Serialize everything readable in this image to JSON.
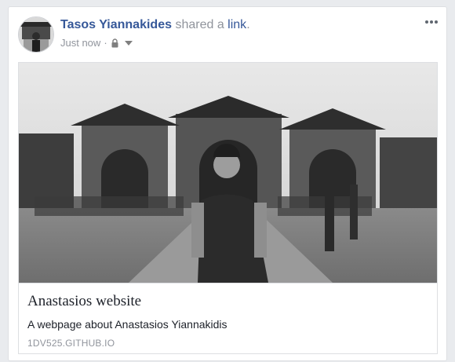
{
  "post": {
    "author": "Tasos Yiannakides",
    "action_text": "shared a",
    "link_word": "link",
    "period": ".",
    "timestamp": "Just now",
    "separator": "·",
    "privacy_icon": "lock-icon",
    "audience_icon": "chevron-down-icon",
    "more_icon": "more-dots-icon"
  },
  "link_card": {
    "title": "Anastasios website",
    "description": "A webpage about Anastasios Yiannakidis",
    "domain": "1DV525.GITHUB.IO"
  },
  "colors": {
    "author": "#365899",
    "meta": "#90949c",
    "border": "#dddfe2",
    "background": "#e9ebee"
  }
}
